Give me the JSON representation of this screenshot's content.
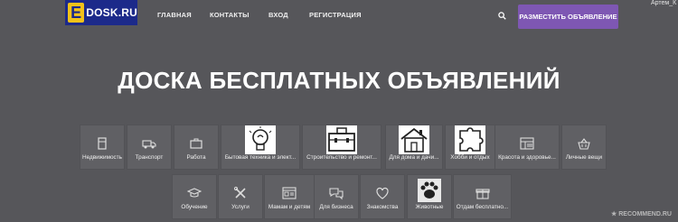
{
  "header": {
    "logo_text": "DOSK.RU",
    "logo_letter": "E",
    "nav": [
      "ГЛАВНАЯ",
      "КОНТАКТЫ",
      "ВХОД",
      "РЕГИСТРАЦИЯ"
    ],
    "post_button": "РАЗМЕСТИТЬ ОБЪЯВЛЕНИЕ",
    "user_label": "Артем_К"
  },
  "headline": "ДОСКА БЕСПЛАТНЫХ ОБЪЯВЛЕНИЙ",
  "categories_row1": [
    {
      "label": "Недвижимость",
      "icon": "fridge-icon"
    },
    {
      "label": "Транспорт",
      "icon": "truck-icon"
    },
    {
      "label": "Работа",
      "icon": "briefcase-icon"
    },
    {
      "label": "Бытовая техника и элект...",
      "icon": "lightbulb-icon"
    },
    {
      "label": "Строительство и ремонт...",
      "icon": "toolbox-icon"
    },
    {
      "label": "Для дома и дачи...",
      "icon": "house-icon"
    },
    {
      "label": "Хобби и отдых",
      "icon": "puzzle-icon"
    },
    {
      "label": "Красота и здоровье...",
      "icon": "grid-icon"
    },
    {
      "label": "Личные вещи",
      "icon": "basket-icon"
    }
  ],
  "categories_row2": [
    {
      "label": "Обучение",
      "icon": "graduation-cap-icon"
    },
    {
      "label": "Услуги",
      "icon": "tools-icon"
    },
    {
      "label": "Мамам и детям",
      "icon": "window-icon"
    },
    {
      "label": "Для бизнеса",
      "icon": "chat-icon"
    },
    {
      "label": "Знакомства",
      "icon": "heart-icon"
    },
    {
      "label": "Животные",
      "icon": "paw-icon"
    },
    {
      "label": "Отдам бесплатно...",
      "icon": "gift-icon"
    }
  ],
  "watermark": "★ RECOMMEND.RU"
}
